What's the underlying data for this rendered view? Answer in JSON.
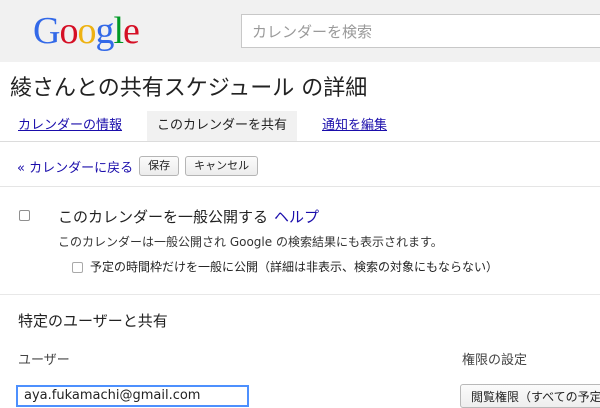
{
  "header": {
    "logo_letters": [
      {
        "ch": "G",
        "color": "#3369e8"
      },
      {
        "ch": "o",
        "color": "#d50f25"
      },
      {
        "ch": "o",
        "color": "#eeb211"
      },
      {
        "ch": "g",
        "color": "#3369e8"
      },
      {
        "ch": "l",
        "color": "#009925"
      },
      {
        "ch": "e",
        "color": "#d50f25"
      }
    ],
    "search_placeholder": "カレンダーを検索"
  },
  "page": {
    "title": "綾さんとの共有スケジュール の詳細"
  },
  "tabs": [
    {
      "label": "カレンダーの情報",
      "state": "link"
    },
    {
      "label": "このカレンダーを共有",
      "state": "active"
    },
    {
      "label": "通知を編集",
      "state": "link"
    }
  ],
  "actions": {
    "back_label": "« カレンダーに戻る",
    "save_label": "保存",
    "cancel_label": "キャンセル"
  },
  "public_sharing": {
    "checkbox_label": "このカレンダーを一般公開する",
    "help_label": "ヘルプ",
    "description": "このカレンダーは一般公開され Google の検索結果にも表示されます。",
    "busy_only_label": "予定の時間枠だけを一般に公開（詳細は非表示、検索の対象にもならない）",
    "public_checked": false,
    "busy_only_checked": false
  },
  "specific_sharing": {
    "title": "特定のユーザーと共有",
    "column_user": "ユーザー",
    "column_permission": "権限の設定",
    "email_value": "aya.fukamachi@gmail.com",
    "permission_value": "閲覧権限（すべての予定の詳細）"
  },
  "colors": {
    "link": "#1a0dab",
    "focus_border": "#4d90fe",
    "header_bg": "#f1f1f1"
  }
}
